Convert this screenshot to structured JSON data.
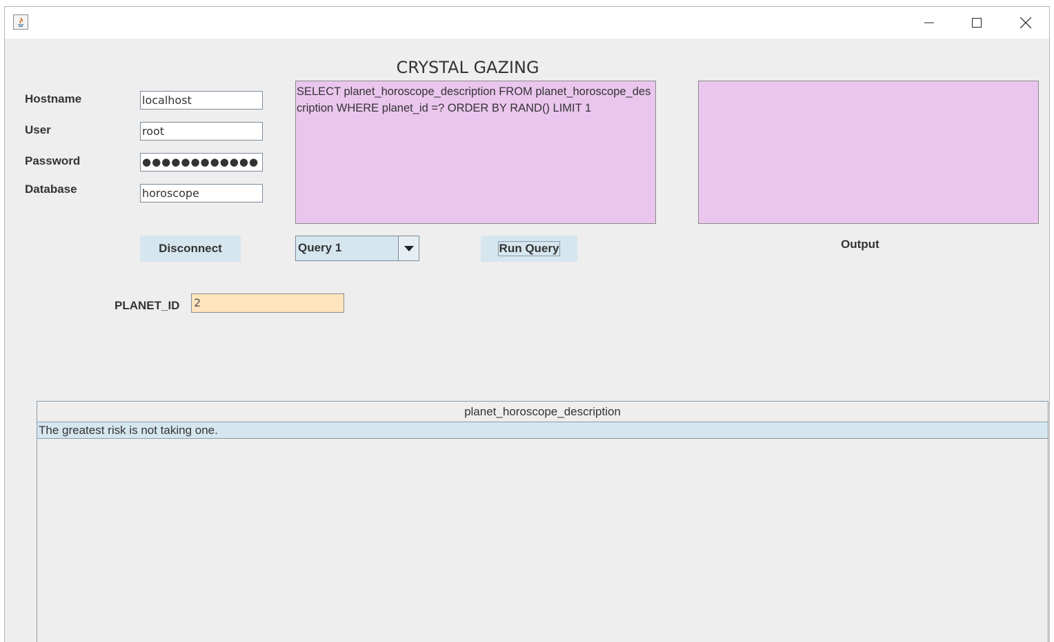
{
  "window": {
    "title": "",
    "controls": {
      "minimize": "minimize-icon",
      "maximize": "maximize-icon",
      "close": "close-icon"
    }
  },
  "app_title": "CRYSTAL GAZING",
  "connection": {
    "hostname_label": "Hostname",
    "hostname_value": "localhost",
    "user_label": "User",
    "user_value": "root",
    "password_label": "Password",
    "password_value": "●●●●●●●●●●●●",
    "database_label": "Database",
    "database_value": "horoscope",
    "disconnect_label": "Disconnect"
  },
  "query": {
    "text": "SELECT planet_horoscope_description FROM planet_horoscope_description WHERE planet_id =? ORDER BY RAND() LIMIT 1",
    "selected": "Query 1",
    "run_label": "Run Query"
  },
  "output": {
    "label": "Output"
  },
  "parameter": {
    "label": "PLANET_ID",
    "value": "2"
  },
  "results": {
    "columns": [
      "planet_horoscope_description"
    ],
    "rows": [
      [
        "The greatest risk is not taking one."
      ]
    ]
  },
  "colors": {
    "query_bg": "#eac6ee",
    "button_bg": "#d6e6ef",
    "param_bg": "#ffe4bd",
    "window_bg": "#eeeeee"
  }
}
